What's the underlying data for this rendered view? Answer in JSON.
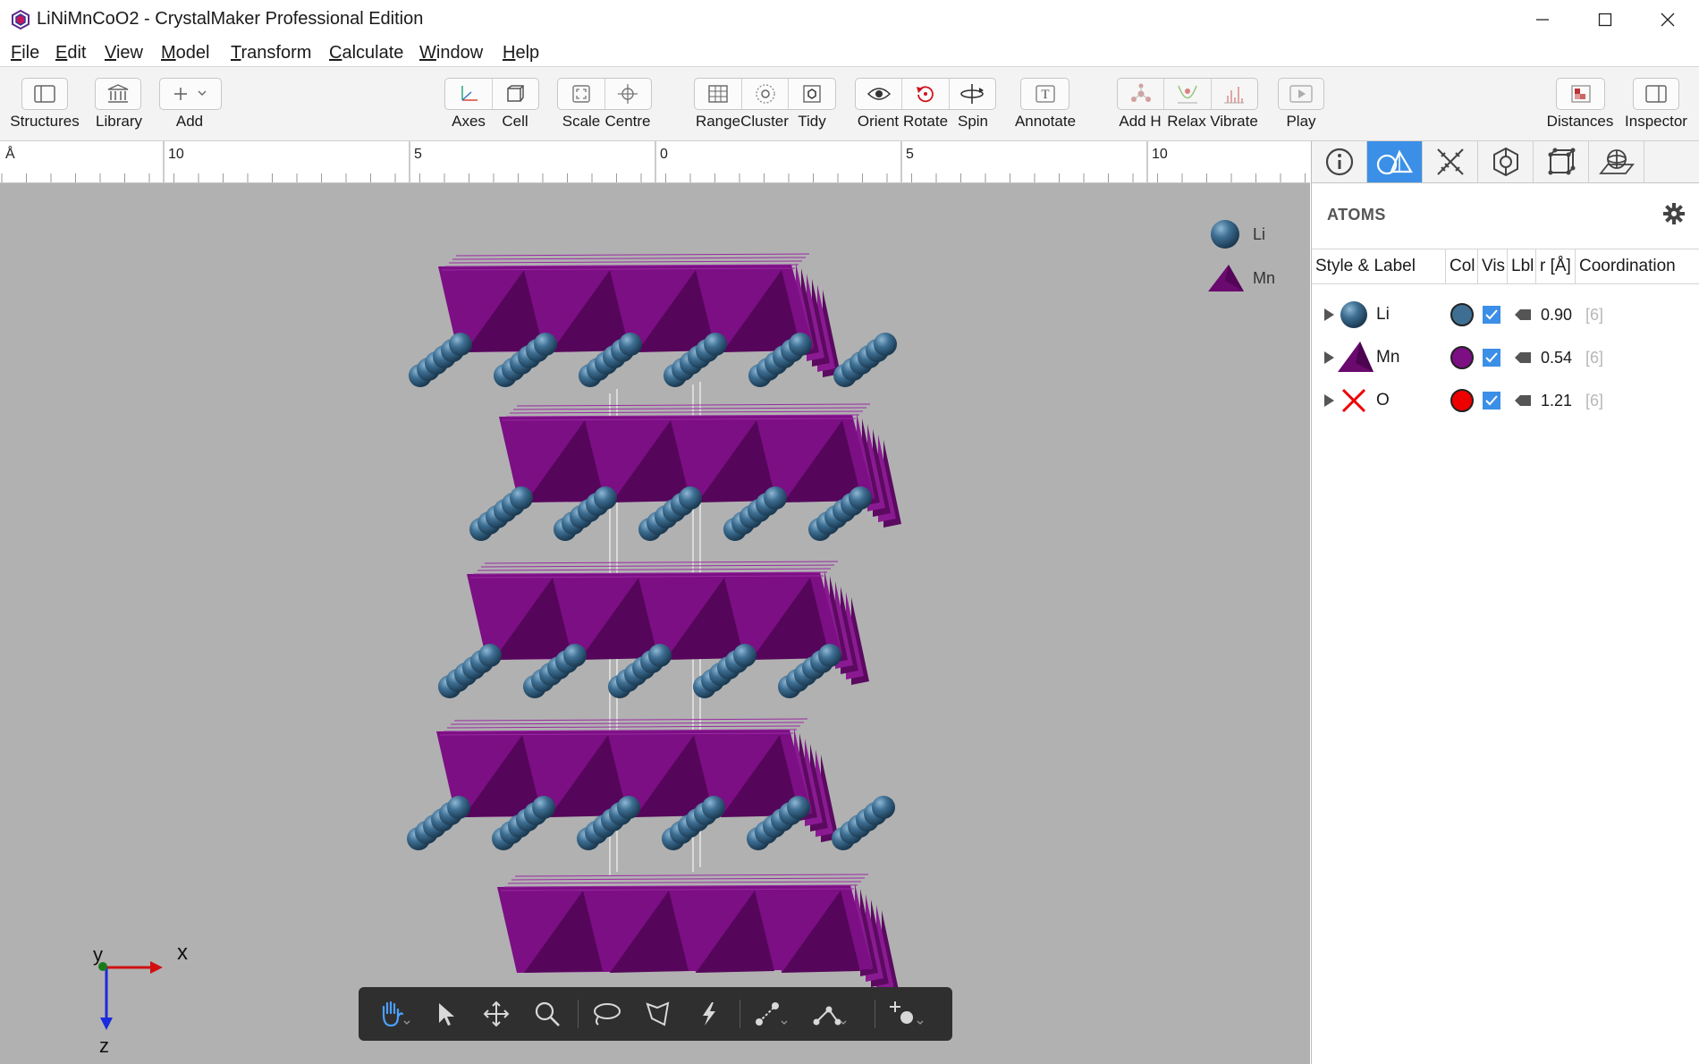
{
  "window": {
    "title": "LiNiMnCoO2 - CrystalMaker Professional Edition"
  },
  "menu": [
    "File",
    "Edit",
    "View",
    "Model",
    "Transform",
    "Calculate",
    "Window",
    "Help"
  ],
  "toolbar": {
    "structures": "Structures",
    "library": "Library",
    "add": "Add",
    "axes": "Axes",
    "cell": "Cell",
    "scale": "Scale",
    "centre": "Centre",
    "range": "Range",
    "cluster": "Cluster",
    "tidy": "Tidy",
    "orient": "Orient",
    "rotate": "Rotate",
    "spin": "Spin",
    "annotate": "Annotate",
    "add_h": "Add H",
    "relax": "Relax",
    "vibrate": "Vibrate",
    "play": "Play",
    "distances": "Distances",
    "inspector": "Inspector"
  },
  "ruler": {
    "unit": "Å",
    "labels": [
      "10",
      "5",
      "0",
      "5",
      "10"
    ]
  },
  "viewport": {
    "legend": [
      {
        "element": "Li",
        "shape": "sphere",
        "color": "#3e6f93"
      },
      {
        "element": "Mn",
        "shape": "tetrahedron",
        "color": "#6a0a6e"
      }
    ],
    "axes": {
      "x": "x",
      "y": "y",
      "z": "z"
    }
  },
  "colors": {
    "li": "#3e6f93",
    "mn": "#7c0f84",
    "mn_dark": "#55065a",
    "o": "#ee0000",
    "viewport_bg": "#b1b1b1",
    "accent": "#3b8fe6"
  },
  "panel": {
    "section_title": "ATOMS",
    "columns": [
      "Style & Label",
      "Col",
      "Vis",
      "Lbl",
      "r [Å]",
      "Coordination"
    ],
    "atoms": [
      {
        "label": "Li",
        "style_icon": "sphere-icon",
        "color": "#3e6f93",
        "visible": true,
        "radius": "0.90",
        "coordination": "[6]"
      },
      {
        "label": "Mn",
        "style_icon": "tetrahedron-icon",
        "color": "#7c0f84",
        "visible": true,
        "radius": "0.54",
        "coordination": "[6]"
      },
      {
        "label": "O",
        "style_icon": "cross-icon",
        "color": "#ee0000",
        "visible": true,
        "radius": "1.21",
        "coordination": "[6]"
      }
    ]
  }
}
